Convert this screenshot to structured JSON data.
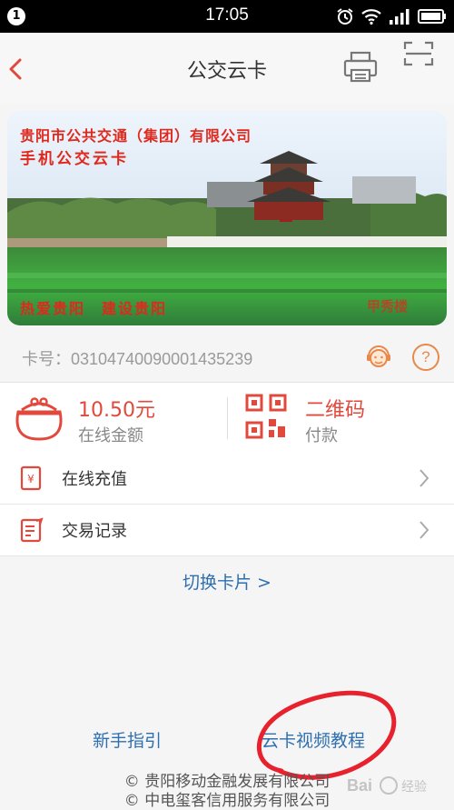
{
  "status_bar": {
    "notification_count": "1",
    "time": "17:05"
  },
  "nav": {
    "title": "公交云卡"
  },
  "card": {
    "company": "贵阳市公共交通（集团）有限公司",
    "card_name": "手机公交云卡",
    "slogan": "热爱贵阳　建设贵阳",
    "stamp": "甲秀楼"
  },
  "card_info": {
    "card_number": "卡号：03104740090001435239"
  },
  "balance": {
    "amount": "10.50元",
    "label": "在线金额"
  },
  "qr_pay": {
    "title": "二维码",
    "label": "付款"
  },
  "menu": [
    {
      "label": "在线充值",
      "icon": "recharge-icon"
    },
    {
      "label": "交易记录",
      "icon": "transaction-record-icon"
    }
  ],
  "switch_card": "切换卡片 >",
  "footer": {
    "guide_link": "新手指引",
    "video_link": "云卡视频教程",
    "copyright1": "© 贵阳移动金融发展有限公司",
    "copyright2": "© 中电玺客信用服务有限公司",
    "watermark": "Baidu 经验"
  },
  "colors": {
    "accent": "#e2483c",
    "link": "#2e6fb0",
    "annotation": "#e8212e"
  }
}
